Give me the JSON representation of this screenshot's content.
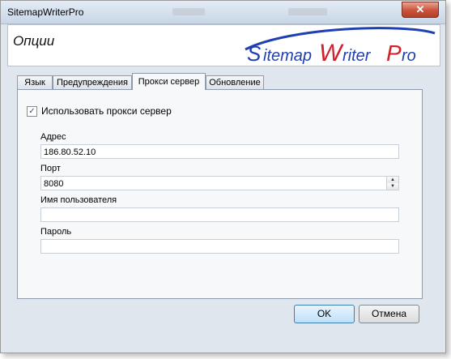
{
  "window": {
    "title": "SitemapWriterPro",
    "close_symbol": "✕"
  },
  "header": {
    "title": "Опции",
    "logo_text": "Sitemap Writer Pro",
    "logo_parts": {
      "a": "S",
      "b": "itemap",
      "c": "W",
      "d": "riter",
      "e": "P",
      "f": "ro"
    },
    "colors": {
      "blue": "#1f3fb2",
      "red": "#d0202a"
    }
  },
  "tabs": [
    {
      "label": "Язык",
      "active": false
    },
    {
      "label": "Предупреждения",
      "active": false
    },
    {
      "label": "Прокси сервер",
      "active": true
    },
    {
      "label": "Обновление",
      "active": false
    }
  ],
  "proxy": {
    "use_proxy_label": "Использовать прокси сервер",
    "use_proxy_checked": true,
    "address_label": "Адрес",
    "address_value": "186.80.52.10",
    "port_label": "Порт",
    "port_value": "8080",
    "username_label": "Имя пользователя",
    "username_value": "",
    "password_label": "Пароль",
    "password_value": ""
  },
  "buttons": {
    "ok": "OK",
    "cancel": "Отмена"
  }
}
